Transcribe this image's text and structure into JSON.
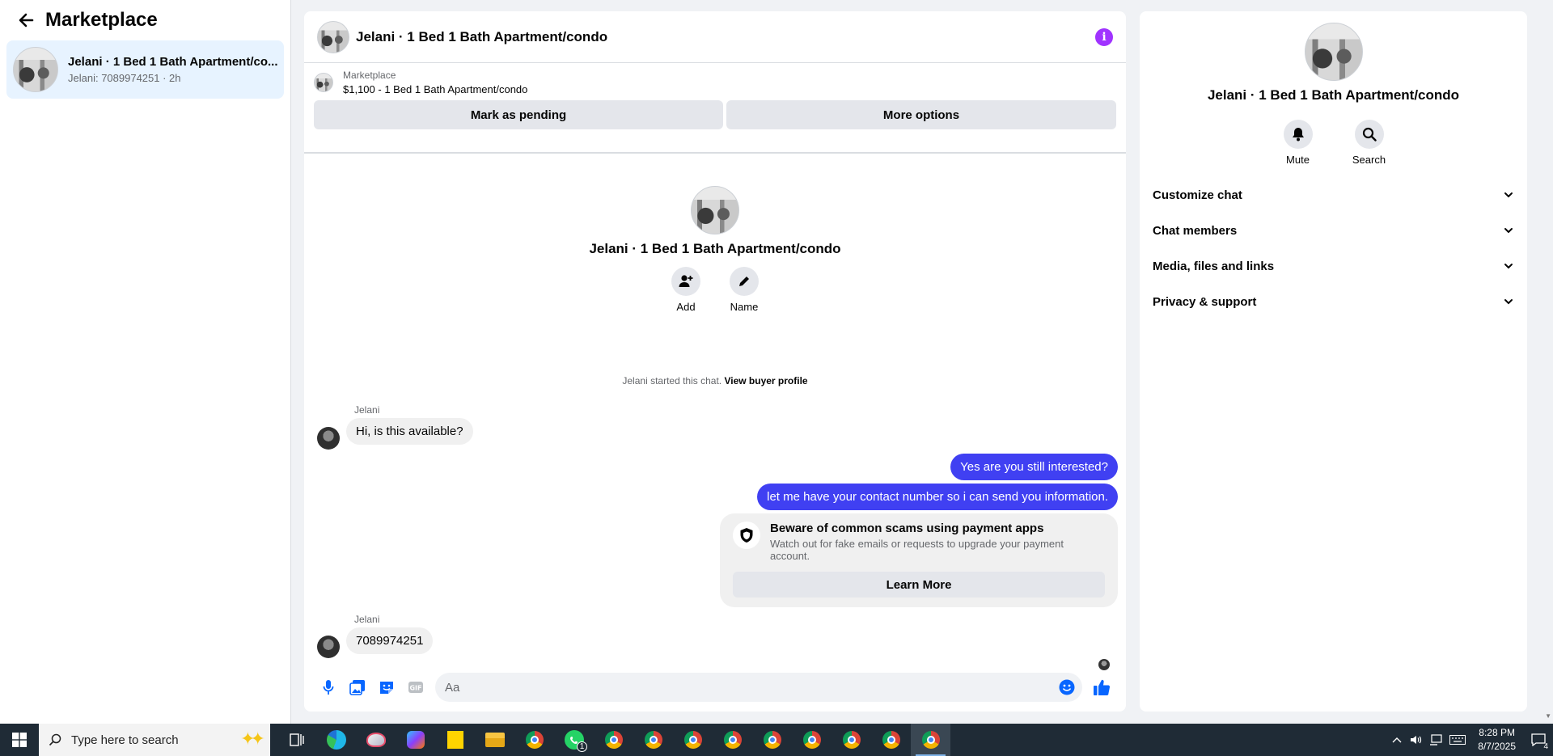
{
  "sidebar": {
    "title": "Marketplace",
    "conversations": [
      {
        "title": "Jelani · 1 Bed 1 Bath Apartment/condo",
        "title_display": "Jelani · 1 Bed 1 Bath Apartment/co...",
        "subtitle": "Jelani: 7089974251 · 2h"
      }
    ]
  },
  "chat": {
    "header_title": "Jelani · 1 Bed 1 Bath Apartment/condo",
    "listing": {
      "source": "Marketplace",
      "price_title": "$1,100 - 1 Bed 1 Bath Apartment/condo",
      "mark_pending_label": "Mark as pending",
      "more_options_label": "More options"
    },
    "intro": {
      "title": "Jelani · 1 Bed 1 Bath Apartment/condo",
      "add_label": "Add",
      "name_label": "Name",
      "started_text": "Jelani started this chat.",
      "view_profile_label": "View buyer profile"
    },
    "messages": [
      {
        "sender": "Jelani",
        "text": "Hi, is this available?",
        "direction": "in"
      },
      {
        "text": "Yes are you still interested?",
        "direction": "out"
      },
      {
        "text": "let me have your contact number so i can send you information.",
        "direction": "out"
      },
      {
        "sender": "Jelani",
        "text": "7089974251",
        "direction": "in"
      }
    ],
    "scam_notice": {
      "title": "Beware of common scams using payment apps",
      "description": "Watch out for fake emails or requests to upgrade your payment account.",
      "button_label": "Learn More"
    },
    "composer": {
      "placeholder": "Aa"
    },
    "colors": {
      "outgoing_bubble": "#4040f2",
      "accent": "#0866ff",
      "info": "#a033ff"
    }
  },
  "info_panel": {
    "title": "Jelani · 1 Bed 1 Bath Apartment/condo",
    "mute_label": "Mute",
    "search_label": "Search",
    "sections": [
      {
        "label": "Customize chat"
      },
      {
        "label": "Chat members"
      },
      {
        "label": "Media, files and links"
      },
      {
        "label": "Privacy & support"
      }
    ]
  },
  "taskbar": {
    "search_placeholder": "Type here to search",
    "time": "8:28 PM",
    "date": "8/7/2025",
    "notification_count": "4",
    "whatsapp_badge": "1"
  }
}
